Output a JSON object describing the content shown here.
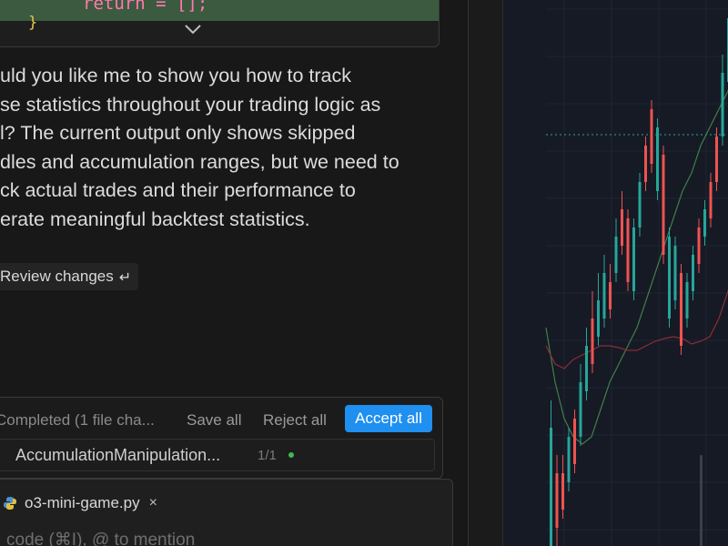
{
  "code": {
    "line_text": "return = [];",
    "closing_brace": "}"
  },
  "message": {
    "lines": [
      "uld you like me to show you how to track",
      "se statistics throughout your trading logic as",
      "l? The current output only shows skipped",
      "dles and accumulation ranges, but we need to",
      "ck actual trades and their performance to",
      "erate meaningful backtest statistics."
    ]
  },
  "review": {
    "label": "Review changes",
    "return_glyph": "↵"
  },
  "changes": {
    "status": "Completed  (1 file cha...",
    "save_all": "Save all",
    "reject_all": "Reject all",
    "accept_all": "Accept all",
    "file": {
      "name": "AccumulationManipulation...",
      "count": "1/1"
    }
  },
  "composer": {
    "file_chip": "o3-mini-game.py",
    "chip_close": "×",
    "placeholder": "code (⌘I), @ to mention"
  },
  "chart_data": {
    "type": "candlestick",
    "candles": [
      {
        "o": 470,
        "c": 600,
        "h": 440,
        "l": 600
      },
      {
        "o": 520,
        "c": 580,
        "h": 500,
        "l": 600
      },
      {
        "o": 520,
        "c": 560,
        "h": 500,
        "l": 570
      },
      {
        "o": 480,
        "c": 530,
        "h": 470,
        "l": 540
      },
      {
        "o": 460,
        "c": 510,
        "h": 450,
        "l": 520
      },
      {
        "o": 420,
        "c": 480,
        "h": 400,
        "l": 490
      },
      {
        "o": 380,
        "c": 430,
        "h": 360,
        "l": 440
      },
      {
        "o": 350,
        "c": 400,
        "h": 320,
        "l": 410
      },
      {
        "o": 330,
        "c": 370,
        "h": 300,
        "l": 380
      },
      {
        "o": 300,
        "c": 350,
        "h": 280,
        "l": 360
      },
      {
        "o": 310,
        "c": 340,
        "h": 290,
        "l": 350
      },
      {
        "o": 260,
        "c": 300,
        "h": 240,
        "l": 310
      },
      {
        "o": 230,
        "c": 270,
        "h": 210,
        "l": 280
      },
      {
        "o": 240,
        "c": 310,
        "h": 230,
        "l": 320
      },
      {
        "o": 250,
        "c": 320,
        "h": 240,
        "l": 330
      },
      {
        "o": 200,
        "c": 250,
        "h": 190,
        "l": 260
      },
      {
        "o": 160,
        "c": 200,
        "h": 150,
        "l": 210
      },
      {
        "o": 120,
        "c": 180,
        "h": 110,
        "l": 190
      },
      {
        "o": 140,
        "c": 210,
        "h": 130,
        "l": 220
      },
      {
        "o": 170,
        "c": 280,
        "h": 160,
        "l": 290
      },
      {
        "o": 260,
        "c": 350,
        "h": 250,
        "l": 360
      },
      {
        "o": 270,
        "c": 330,
        "h": 260,
        "l": 340
      },
      {
        "o": 300,
        "c": 380,
        "h": 290,
        "l": 390
      },
      {
        "o": 310,
        "c": 350,
        "h": 300,
        "l": 360
      },
      {
        "o": 280,
        "c": 320,
        "h": 270,
        "l": 330
      },
      {
        "o": 250,
        "c": 290,
        "h": 240,
        "l": 300
      },
      {
        "o": 230,
        "c": 260,
        "h": 220,
        "l": 270
      },
      {
        "o": 200,
        "c": 240,
        "h": 190,
        "l": 250
      },
      {
        "o": 150,
        "c": 200,
        "h": 140,
        "l": 210
      },
      {
        "o": 80,
        "c": 150,
        "h": 60,
        "l": 160
      },
      {
        "o": 20,
        "c": 90,
        "h": 0,
        "l": 100
      },
      {
        "o": 0,
        "c": 40,
        "h": 0,
        "l": 50
      }
    ],
    "bull_color": "#26a69a",
    "bear_color": "#ef5350",
    "ma_green": [
      [
        0,
        360
      ],
      [
        10,
        420
      ],
      [
        20,
        460
      ],
      [
        30,
        480
      ],
      [
        40,
        488
      ],
      [
        50,
        480
      ],
      [
        60,
        450
      ],
      [
        70,
        420
      ],
      [
        80,
        400
      ],
      [
        90,
        380
      ],
      [
        100,
        360
      ],
      [
        110,
        330
      ],
      [
        120,
        300
      ],
      [
        130,
        270
      ],
      [
        140,
        240
      ],
      [
        150,
        210
      ],
      [
        160,
        190
      ],
      [
        170,
        160
      ],
      [
        180,
        140
      ],
      [
        190,
        120
      ],
      [
        200,
        100
      ],
      [
        210,
        60
      ],
      [
        220,
        30
      ],
      [
        230,
        0
      ]
    ],
    "ma_red": [
      [
        0,
        380
      ],
      [
        10,
        400
      ],
      [
        20,
        405
      ],
      [
        30,
        395
      ],
      [
        40,
        390
      ],
      [
        50,
        385
      ],
      [
        60,
        380
      ],
      [
        70,
        380
      ],
      [
        80,
        382
      ],
      [
        90,
        385
      ],
      [
        100,
        385
      ],
      [
        110,
        380
      ],
      [
        120,
        375
      ],
      [
        130,
        372
      ],
      [
        140,
        370
      ],
      [
        150,
        372
      ],
      [
        160,
        378
      ],
      [
        170,
        375
      ],
      [
        180,
        370
      ],
      [
        190,
        350
      ],
      [
        200,
        320
      ],
      [
        210,
        290
      ],
      [
        220,
        265
      ],
      [
        230,
        255
      ],
      [
        240,
        240
      ],
      [
        250,
        230
      ]
    ],
    "price_line_y": 148
  }
}
